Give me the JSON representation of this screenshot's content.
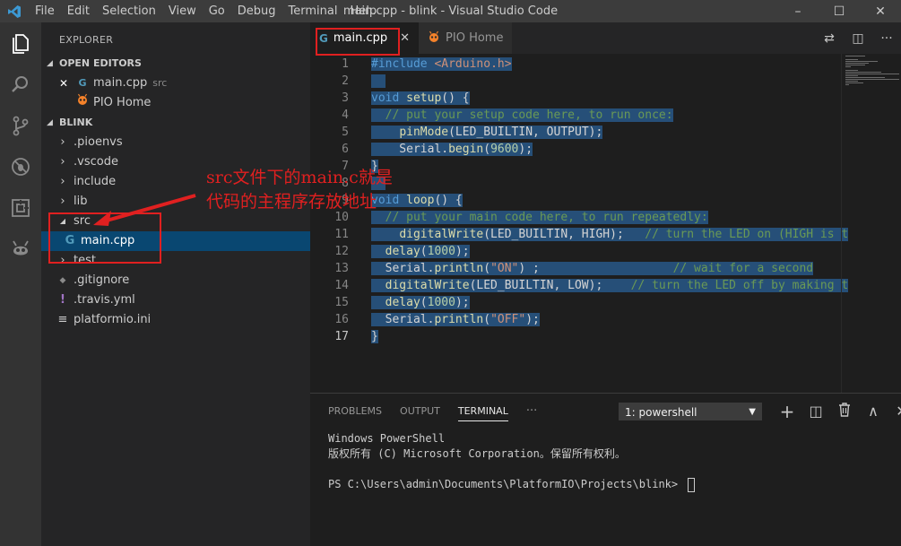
{
  "titlebar": {
    "title": "main.cpp - blink - Visual Studio Code",
    "menu": [
      "File",
      "Edit",
      "Selection",
      "View",
      "Go",
      "Debug",
      "Terminal",
      "Help"
    ],
    "controls": [
      "–",
      "☐",
      "✕"
    ]
  },
  "activity_bar": {
    "icons": [
      "explorer-icon",
      "search-icon",
      "source-control-icon",
      "debug-icon",
      "extensions-icon",
      "platformio-icon"
    ]
  },
  "sidebar": {
    "title": "EXPLORER",
    "open_editors_header": "OPEN EDITORS",
    "open_editors": [
      {
        "close": "✕",
        "icon": "G",
        "label": "main.cpp",
        "desc": "src"
      },
      {
        "icon": "pio",
        "label": "PIO Home",
        "desc": ""
      }
    ],
    "project_header": "BLINK",
    "tree": [
      {
        "twisty": "›",
        "label": ".pioenvs"
      },
      {
        "twisty": "›",
        "label": ".vscode"
      },
      {
        "twisty": "›",
        "label": "include"
      },
      {
        "twisty": "›",
        "label": "lib"
      },
      {
        "twisty": "◢",
        "label": "src"
      },
      {
        "twisty": "",
        "label": "main.cpp",
        "icon": "G"
      },
      {
        "twisty": "›",
        "label": "test"
      },
      {
        "twisty": "",
        "label": ".gitignore",
        "icon": "◆"
      },
      {
        "twisty": "",
        "label": ".travis.yml",
        "icon": "!"
      },
      {
        "twisty": "",
        "label": "platformio.ini",
        "icon": "≡"
      }
    ]
  },
  "tabs": [
    {
      "label": "main.cpp",
      "icon": "G",
      "close": "✕"
    },
    {
      "label": "PIO Home",
      "icon": "pio"
    }
  ],
  "tab_actions": [
    "⇄",
    "◫",
    "···"
  ],
  "editor": {
    "line_numbers": [
      "1",
      "2",
      "3",
      "4",
      "5",
      "6",
      "7",
      "8",
      "9",
      "10",
      "11",
      "12",
      "13",
      "14",
      "15",
      "16",
      "17"
    ],
    "current_line": "17"
  },
  "panel": {
    "tabs": [
      "PROBLEMS",
      "OUTPUT",
      "TERMINAL",
      "···"
    ],
    "active_tab": "TERMINAL",
    "terminal_select": "1: powershell",
    "actions": [
      "+",
      "◫",
      "🗑",
      "∧",
      "✕"
    ],
    "terminal_lines": [
      "Windows PowerShell",
      "版权所有 (C) Microsoft Corporation。保留所有权利。",
      "",
      "PS C:\\Users\\admin\\Documents\\PlatformIO\\Projects\\blink> "
    ]
  },
  "annotation": {
    "line1": "src文件下的main.c就是",
    "line2": "代码的主程序存放地址",
    "color": "#e02020"
  }
}
